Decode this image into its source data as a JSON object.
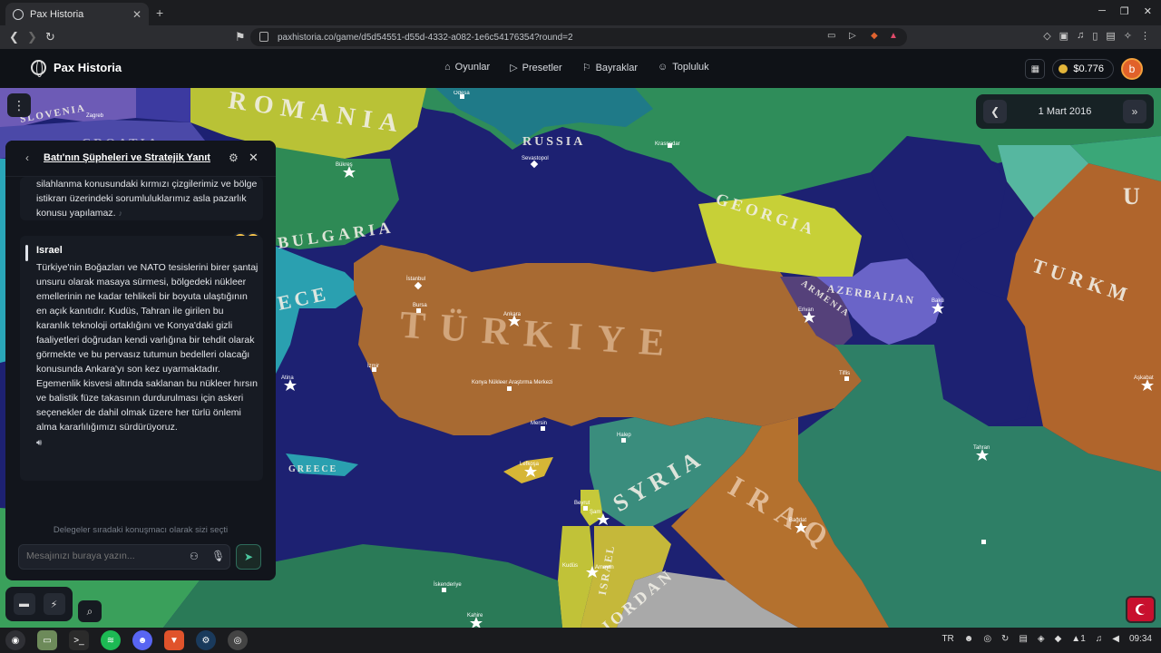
{
  "browser": {
    "tab_title": "Pax Historia",
    "url": "paxhistoria.co/game/d5d54551-d55d-4332-a082-1e6c54176354?round=2"
  },
  "header": {
    "app_name": "Pax Historia",
    "nav": [
      {
        "label": "Oyunlar",
        "icon": "gamepad-icon"
      },
      {
        "label": "Presetler",
        "icon": "play-icon"
      },
      {
        "label": "Bayraklar",
        "icon": "flag-icon"
      },
      {
        "label": "Topluluk",
        "icon": "people-icon"
      }
    ],
    "balance": "$0.776",
    "avatar_letter": "b"
  },
  "date_control": {
    "date": "1 Mart 2016"
  },
  "chat": {
    "title": "Batı'nın Şüpheleri ve Stratejik Yanıt",
    "prev_message": "silahlanma konusundaki kırmızı çizgilerimiz ve bölge istikrarı üzerindeki sorumluluklarımız asla pazarlık konusu yapılamaz.",
    "message": {
      "sender": "Israel",
      "text": "Türkiye'nin Boğazları ve NATO tesislerini birer şantaj unsuru olarak masaya sürmesi, bölgedeki nükleer emellerinin ne kadar tehlikeli bir boyuta ulaştığının en açık kanıtıdır. Kudüs, Tahran ile girilen bu karanlık teknoloji ortaklığını ve Konya'daki gizli faaliyetleri doğrudan kendi varlığına bir tehdit olarak görmekte ve bu pervasız tutumun bedelleri olacağı konusunda Ankara'yı son kez uyarmaktadır. Egemenlik kisvesi altında saklanan bu nükleer hırsın ve balistik füze takasının durdurulması için askeri seçenekler de dahil olmak üzere her türlü önlemi alma kararlılığımızı sürdürüyoruz."
    },
    "status": "Delegeler sıradaki konuşmacı olarak sizi seçti",
    "input_placeholder": "Mesajınızı buraya yazın..."
  },
  "map": {
    "countries": [
      {
        "label": "ROMANIA",
        "color": "#b9c236"
      },
      {
        "label": "RUSSIA",
        "color": "#2e8a5d"
      },
      {
        "label": "BULGARIA",
        "color": "#2e8a55"
      },
      {
        "label": "GEORGIA",
        "color": "#c7d037"
      },
      {
        "label": "AZERBAIJAN",
        "color": "#6a64c8"
      },
      {
        "label": "ARMENIA",
        "color": "#55417a"
      },
      {
        "label": "TURKMEN",
        "color": "#b0652c"
      },
      {
        "label": "TÜRKIYE",
        "color": "#a86a32"
      },
      {
        "label": "SYRIA",
        "color": "#3a8d7d"
      },
      {
        "label": "IRAQ",
        "color": "#b4712e"
      },
      {
        "label": "GREECE",
        "color": "#2aa0b0"
      },
      {
        "label": "JORDAN",
        "color": "#c5b83a"
      },
      {
        "label": "ISRAEL",
        "color": "#c1c238"
      },
      {
        "label": "SLOVENIA",
        "color": "#6d5bb6"
      },
      {
        "label": "CROATIA",
        "color": "#4b49a8"
      },
      {
        "label": "ECE",
        "color": "#2aa0b0"
      },
      {
        "label": "U",
        "color": "#3aa778"
      }
    ],
    "cities": [
      "Odesa",
      "Krasnodar",
      "Sevastopol",
      "Bükreş",
      "İstanbul",
      "Ankara",
      "Bursa",
      "İzmir",
      "Atina",
      "Konya Nükleer Araştırma Merkezi",
      "Tiflis",
      "Bakü",
      "Erivan",
      "Tebriz",
      "Tahran",
      "Lefkoşa",
      "Halep",
      "Şam",
      "Beyrut",
      "Amman",
      "Bağdat",
      "Kudüs",
      "İskenderiye",
      "Kahire",
      "Aşkabat",
      "İsfahan",
      "Mersin",
      "Zagreb"
    ]
  },
  "taskbar": {
    "lang": "TR",
    "time": "09:34"
  }
}
